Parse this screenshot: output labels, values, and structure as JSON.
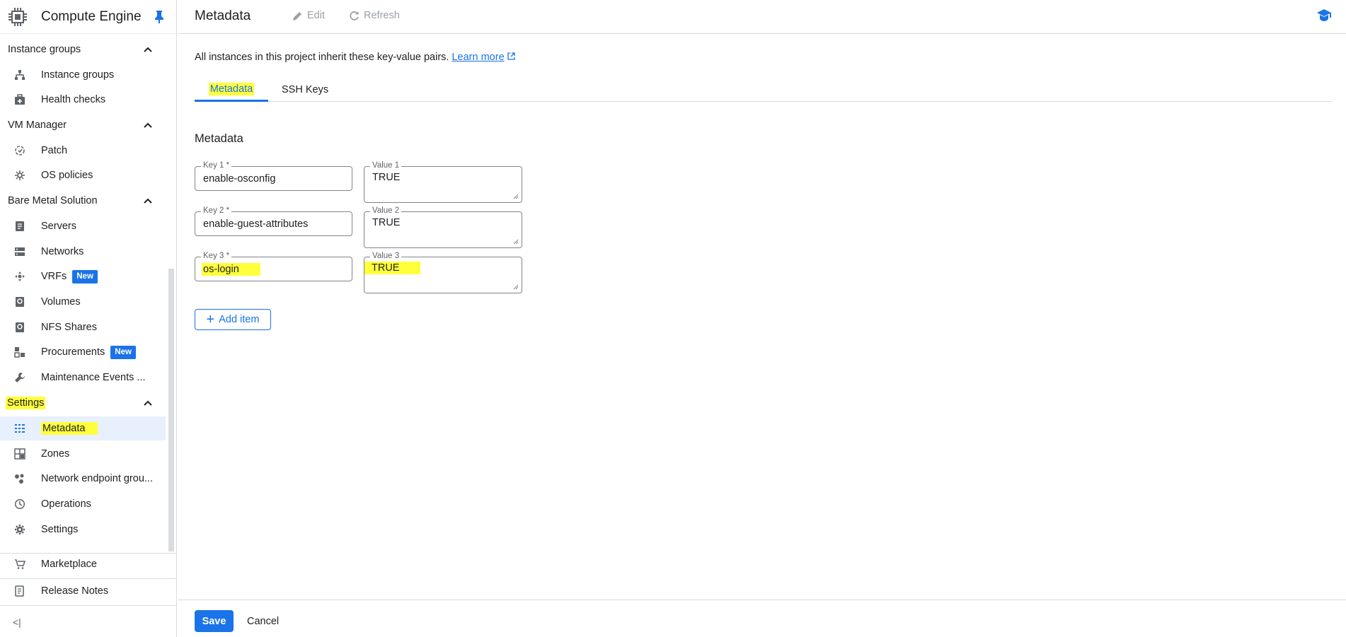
{
  "app": {
    "title": "Compute Engine"
  },
  "sidebar": {
    "sections": [
      {
        "label": "Instance groups",
        "items": [
          {
            "label": "Instance groups",
            "icon": "instance-groups-icon"
          },
          {
            "label": "Health checks",
            "icon": "health-checks-icon"
          }
        ]
      },
      {
        "label": "VM Manager",
        "items": [
          {
            "label": "Patch",
            "icon": "patch-icon"
          },
          {
            "label": "OS policies",
            "icon": "os-policies-icon"
          }
        ]
      },
      {
        "label": "Bare Metal Solution",
        "items": [
          {
            "label": "Servers",
            "icon": "servers-icon"
          },
          {
            "label": "Networks",
            "icon": "networks-icon"
          },
          {
            "label": "VRFs",
            "icon": "vrfs-icon",
            "badge": "New"
          },
          {
            "label": "Volumes",
            "icon": "volumes-icon"
          },
          {
            "label": "NFS Shares",
            "icon": "nfs-shares-icon"
          },
          {
            "label": "Procurements",
            "icon": "procurements-icon",
            "badge": "New"
          },
          {
            "label": "Maintenance Events ...",
            "icon": "wrench-icon"
          }
        ]
      },
      {
        "label": "Settings",
        "items": [
          {
            "label": "Metadata",
            "icon": "metadata-icon",
            "active": true
          },
          {
            "label": "Zones",
            "icon": "zones-icon"
          },
          {
            "label": "Network endpoint grou...",
            "icon": "network-endpoint-icon"
          },
          {
            "label": "Operations",
            "icon": "clock-icon"
          },
          {
            "label": "Settings",
            "icon": "gear-icon"
          }
        ]
      }
    ],
    "bottom": [
      {
        "label": "Marketplace",
        "icon": "cart-icon"
      },
      {
        "label": "Release Notes",
        "icon": "release-notes-icon"
      }
    ],
    "collapse_label": "<|"
  },
  "topbar": {
    "title": "Metadata",
    "edit_label": "Edit",
    "refresh_label": "Refresh"
  },
  "main": {
    "intro_text": "All instances in this project inherit these key-value pairs.",
    "learn_more": "Learn more",
    "tabs": [
      {
        "label": "Metadata",
        "active": true
      },
      {
        "label": "SSH Keys",
        "active": false
      }
    ],
    "section_title": "Metadata",
    "items": [
      {
        "key_label": "Key 1 *",
        "key": "enable-osconfig",
        "value_label": "Value 1",
        "value": "TRUE"
      },
      {
        "key_label": "Key 2 *",
        "key": "enable-guest-attributes",
        "value_label": "Value 2",
        "value": "TRUE"
      },
      {
        "key_label": "Key 3 *",
        "key": "os-login",
        "value_label": "Value 3",
        "value": "TRUE"
      }
    ],
    "add_item_label": "Add item"
  },
  "footer": {
    "save_label": "Save",
    "cancel_label": "Cancel"
  },
  "colors": {
    "accent": "#1a73e8",
    "highlight": "#ffff3b"
  }
}
